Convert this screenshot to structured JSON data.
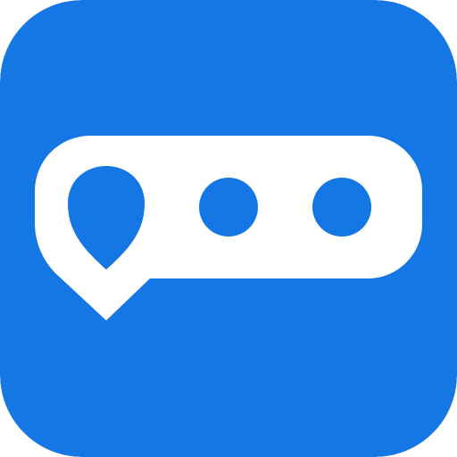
{
  "app_icon": {
    "icon_name": "chat-bubble-location-pin-icon",
    "colors": {
      "background": "#1577E3",
      "foreground": "#FFFFFF"
    },
    "glyph": {
      "pin": "location-pin-icon",
      "dots": [
        "dot-icon",
        "dot-icon"
      ]
    }
  }
}
